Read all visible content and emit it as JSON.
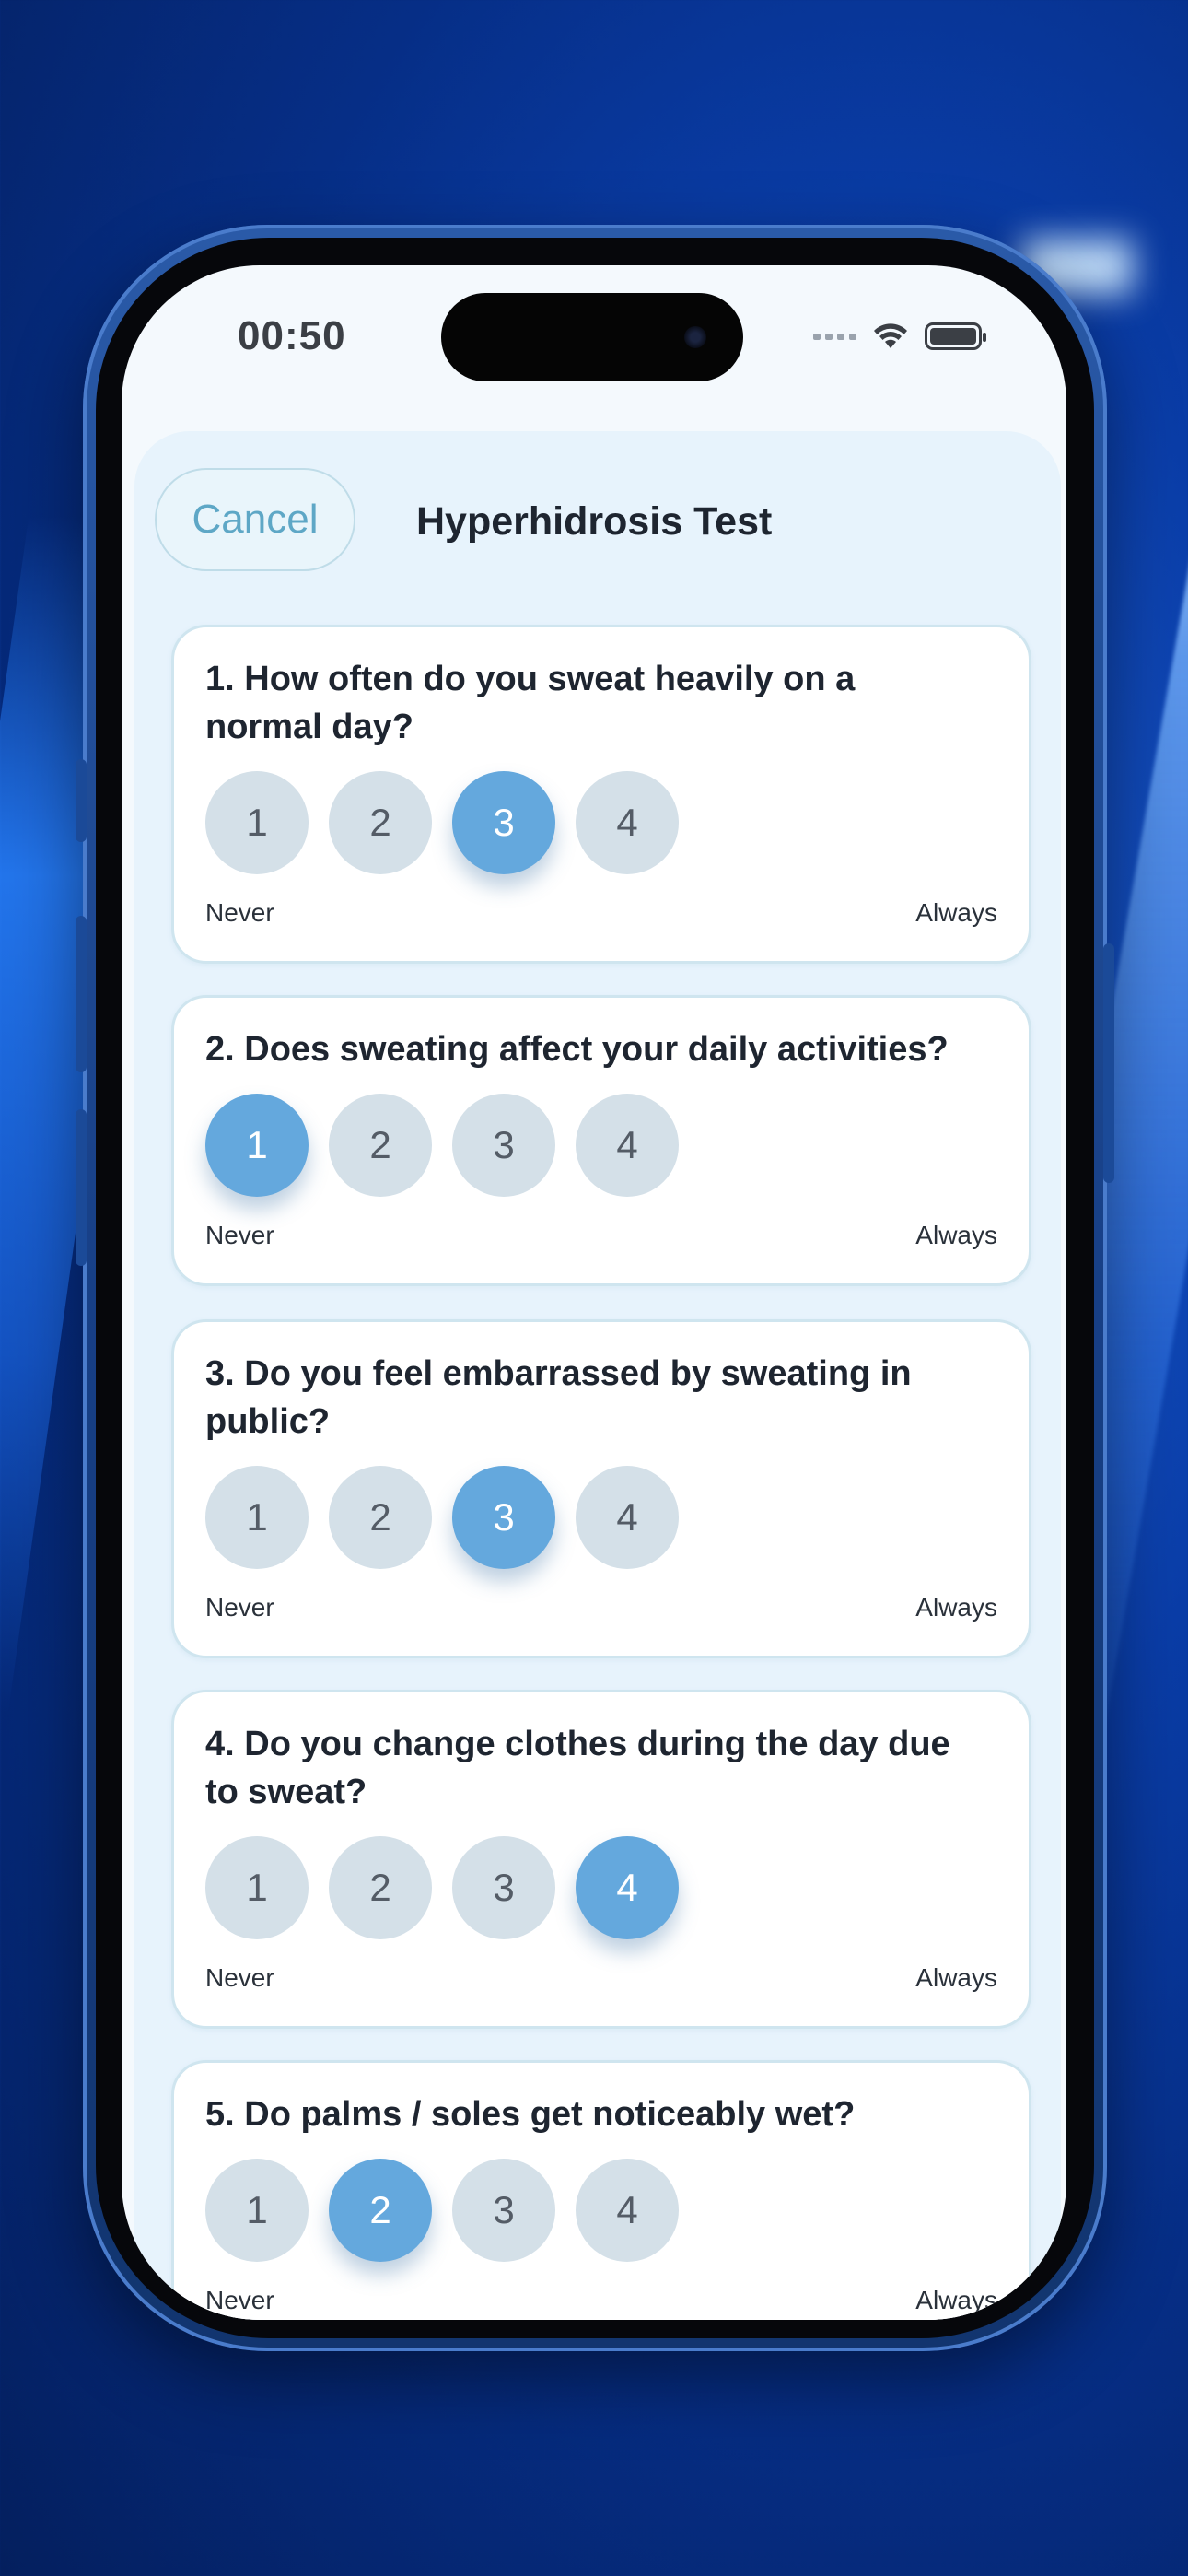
{
  "status_bar": {
    "time": "00:50",
    "icons": [
      "cellular-signal-icon",
      "wifi-icon",
      "battery-icon"
    ]
  },
  "header": {
    "cancel_label": "Cancel",
    "title": "Hyperhidrosis Test"
  },
  "colors": {
    "selected_option": "#64a8dd",
    "unselected_option": "#d4e0e8",
    "card_border": "#cfe5ef",
    "sheet_background": "#e7f3fc",
    "cancel_text": "#5ea7c6"
  },
  "questions": [
    {
      "text": "1. How often do you sweat heavily on a normal day?",
      "options": [
        "1",
        "2",
        "3",
        "4"
      ],
      "selected": "3",
      "min_label": "Never",
      "max_label": "Always"
    },
    {
      "text": "2. Does sweating affect your daily activities?",
      "options": [
        "1",
        "2",
        "3",
        "4"
      ],
      "selected": "1",
      "min_label": "Never",
      "max_label": "Always"
    },
    {
      "text": "3. Do you feel embarrassed by sweating in public?",
      "options": [
        "1",
        "2",
        "3",
        "4"
      ],
      "selected": "3",
      "min_label": "Never",
      "max_label": "Always"
    },
    {
      "text": "4. Do you change clothes during the day due to sweat?",
      "options": [
        "1",
        "2",
        "3",
        "4"
      ],
      "selected": "4",
      "min_label": "Never",
      "max_label": "Always"
    },
    {
      "text": "5. Do palms / soles get noticeably wet?",
      "options": [
        "1",
        "2",
        "3",
        "4"
      ],
      "selected": "2",
      "min_label": "Never",
      "max_label": "Always"
    }
  ]
}
